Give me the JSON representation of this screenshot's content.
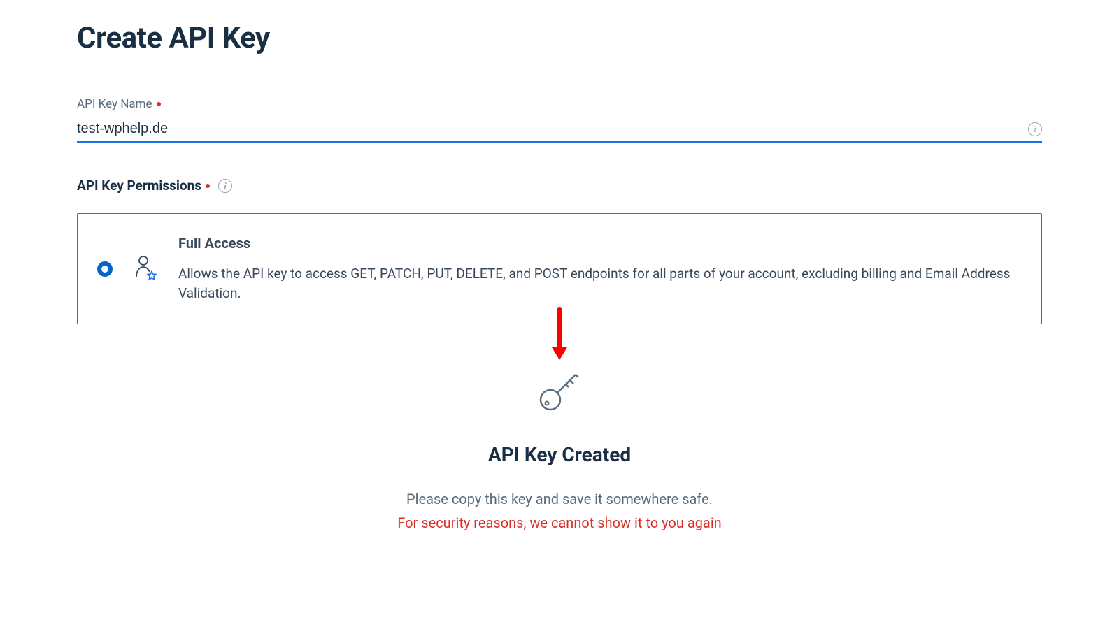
{
  "page": {
    "title": "Create API Key"
  },
  "nameField": {
    "label": "API Key Name",
    "value": "test-wphelp.de"
  },
  "permissions": {
    "header": "API Key Permissions",
    "option": {
      "title": "Full Access",
      "description": "Allows the API key to access GET, PATCH, PUT, DELETE, and POST endpoints for all parts of your account, excluding billing and Email Address Validation."
    }
  },
  "created": {
    "title": "API Key Created",
    "message": "Please copy this key and save it somewhere safe.",
    "warning": "For security reasons, we cannot show it to you again"
  }
}
